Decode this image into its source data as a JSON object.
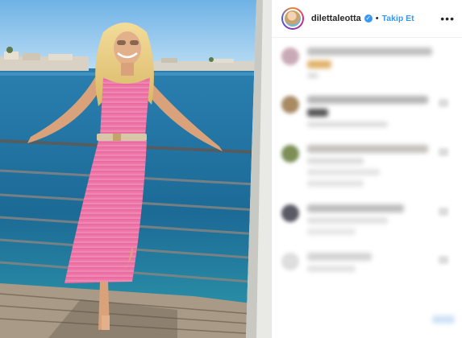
{
  "post": {
    "username": "dilettaleotta",
    "verified_icon": "verified-badge-icon",
    "separator": "•",
    "follow_label": "Takip Et",
    "more_icon": "more-options-icon"
  },
  "colors": {
    "link_blue": "#3897f0",
    "text_dark": "#262626",
    "sea": "#1f6f9b",
    "sky": "#8cc4ea",
    "dress_pink": "#e86ba6"
  }
}
